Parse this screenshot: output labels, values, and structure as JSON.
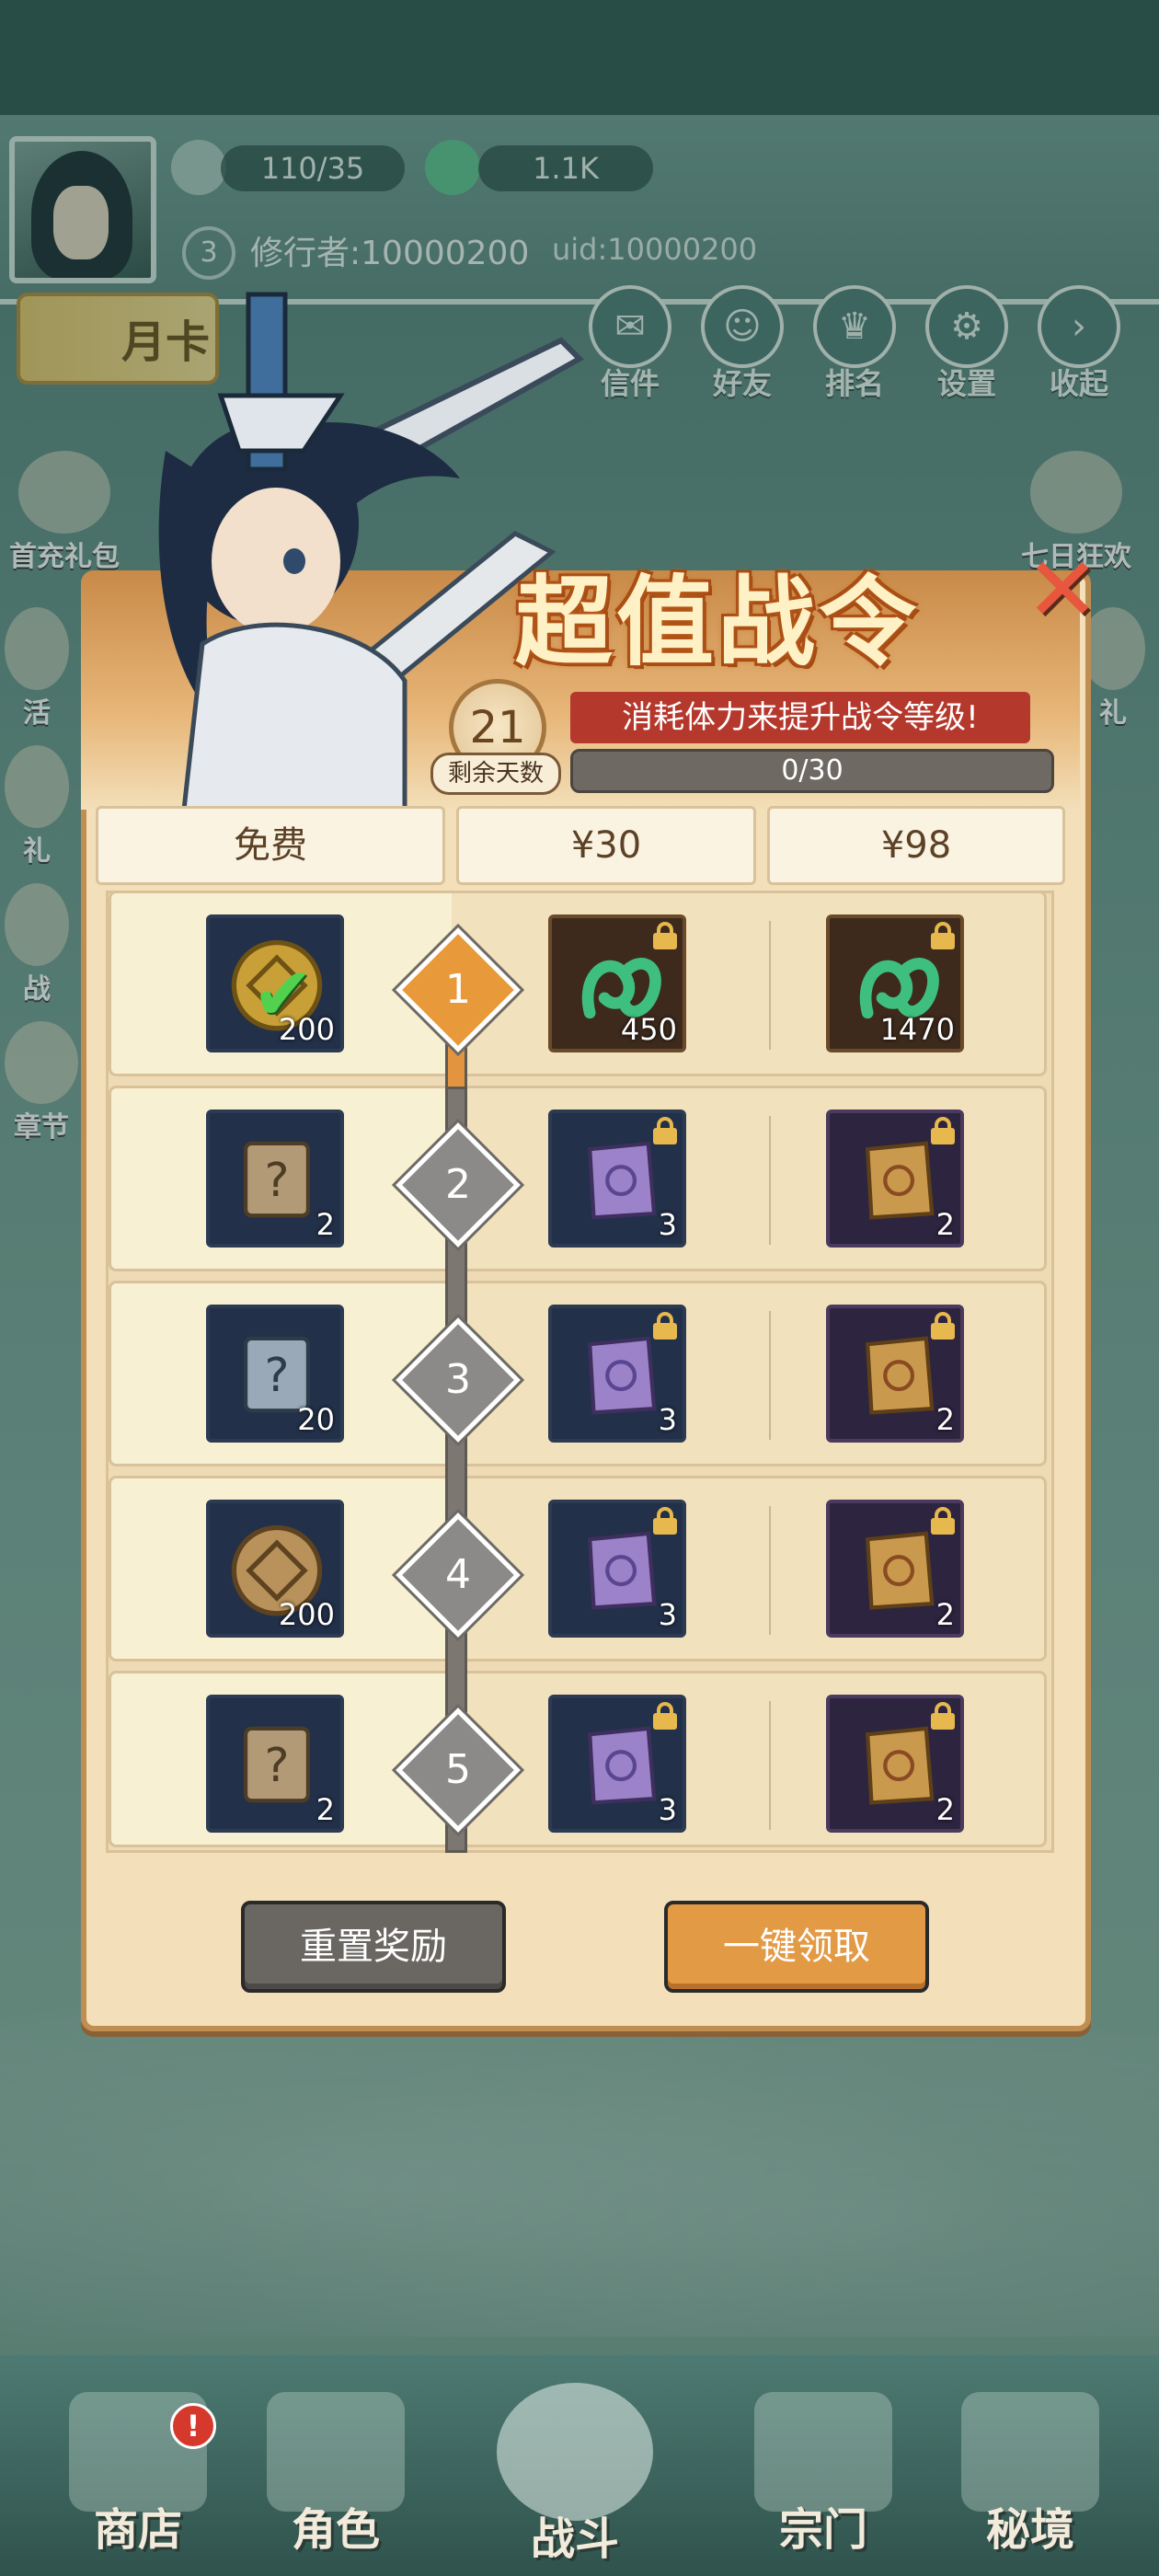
{
  "hud": {
    "stamina": "110/35",
    "jade": "1.1K",
    "level": "3",
    "player_name": "修行者:10000200",
    "uid": "uid:10000200",
    "month_card": "月卡",
    "top_buttons": [
      "信件",
      "好友",
      "排名",
      "设置",
      "收起"
    ],
    "side_left": [
      "首充礼包",
      "活",
      "礼",
      "战",
      "章节"
    ],
    "side_right": [
      "七日狂欢",
      "礼"
    ]
  },
  "battle_pass": {
    "title": "超值战令",
    "subtitle": "消耗体力来提升战令等级!",
    "days_remaining": "21",
    "days_label": "剩余天数",
    "progress_text": "0/30",
    "progress_fraction": 0.0,
    "columns": [
      "免费",
      "¥30",
      "¥98"
    ],
    "rows": [
      {
        "level": "1",
        "free_qty": "200",
        "tier30_qty": "450",
        "tier98_qty": "1470"
      },
      {
        "level": "2",
        "free_qty": "2",
        "tier30_qty": "3",
        "tier98_qty": "2"
      },
      {
        "level": "3",
        "free_qty": "20",
        "tier30_qty": "3",
        "tier98_qty": "2"
      },
      {
        "level": "4",
        "free_qty": "200",
        "tier30_qty": "3",
        "tier98_qty": "2"
      },
      {
        "level": "5",
        "free_qty": "2",
        "tier30_qty": "3",
        "tier98_qty": "2"
      }
    ],
    "reset_button": "重置奖励",
    "claim_all_button": "一键领取"
  },
  "bottom_nav": [
    "商店",
    "角色",
    "战斗",
    "宗门",
    "秘境"
  ],
  "colors": {
    "accent": "#e39a45",
    "panel": "#f3dfb9",
    "danger": "#d5392c"
  }
}
